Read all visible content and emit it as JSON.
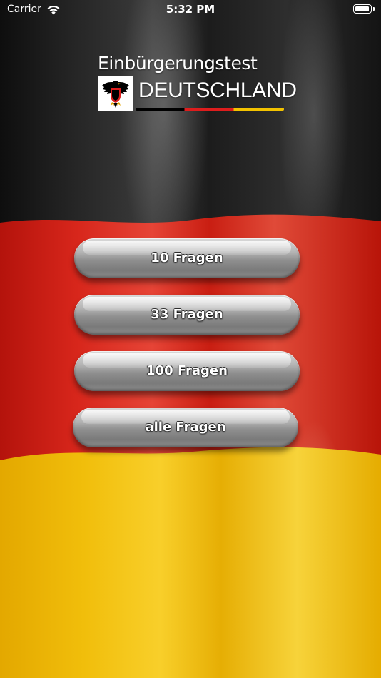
{
  "status_bar": {
    "carrier": "Carrier",
    "time": "5:32 PM",
    "wifi_icon": "wifi-icon",
    "battery_icon": "battery-icon",
    "battery_level": 1.0
  },
  "logo": {
    "title": "Einbürgerungstest",
    "subtitle": "DEUTSCHLAND",
    "emblem_icon": "eagle-emblem-icon"
  },
  "menu": {
    "buttons": [
      {
        "label": "10 Fragen"
      },
      {
        "label": "33 Fragen"
      },
      {
        "label": "100 Fragen"
      },
      {
        "label": "alle Fragen"
      }
    ]
  },
  "colors": {
    "flag_black": "#1f1f1f",
    "flag_red": "#d7261b",
    "flag_gold": "#f1be0b",
    "button_gray": "#9a9a9a",
    "text_white": "#ffffff"
  }
}
